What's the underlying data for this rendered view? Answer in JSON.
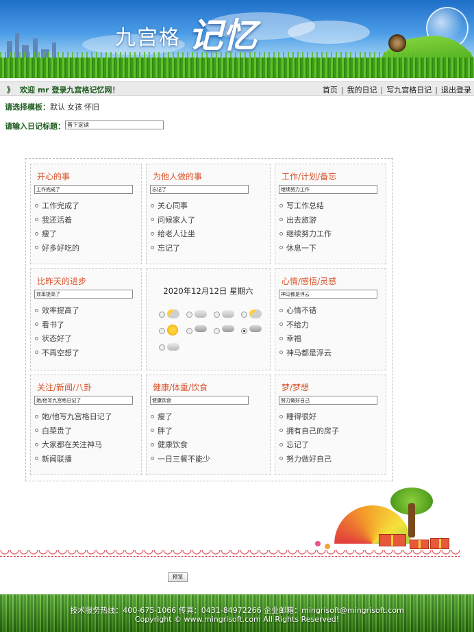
{
  "banner": {
    "logo_text": "九宫格",
    "logo_script": "记忆"
  },
  "topbar": {
    "welcome": "欢迎 mr 登录九宫格记忆网！",
    "nav": [
      "首页",
      "我的日记",
      "写九宫格日记",
      "退出登录"
    ]
  },
  "template": {
    "label": "请选择模板：",
    "options": [
      "默认",
      "女孩",
      "怀旧"
    ]
  },
  "title": {
    "label": "请输入日记标题：",
    "value": "晋下定读"
  },
  "cells": [
    {
      "title": "开心的事",
      "input": "工作完成了",
      "items": [
        "工作完成了",
        "我还活着",
        "瘦了",
        "好多好吃的"
      ]
    },
    {
      "title": "为他人做的事",
      "input": "忘记了",
      "items": [
        "关心同事",
        "问候家人了",
        "给老人让坐",
        "忘记了"
      ]
    },
    {
      "title": "工作/计划/备忘",
      "input": "继续努力工作",
      "items": [
        "写工作总结",
        "出去旅游",
        "继续努力工作",
        "休息一下"
      ]
    },
    {
      "title": "比昨天的进步",
      "input": "效率提高了",
      "items": [
        "效率提高了",
        "看书了",
        "状态好了",
        "不再空想了"
      ]
    },
    {
      "title": "心情/感悟/灵感",
      "input": "神马都是浮云",
      "items": [
        "心情不错",
        "不给力",
        "幸福",
        "神马都是浮云"
      ]
    },
    {
      "title": "关注/新闻/八卦",
      "input": "她/他写九宫格日记了",
      "items": [
        "她/他写九宫格日记了",
        "白菜贵了",
        "大家都在关注神马",
        "新闻联播"
      ]
    },
    {
      "title": "健康/体重/饮食",
      "input": "健康饮食",
      "items": [
        "瘦了",
        "胖了",
        "健康饮食",
        "一日三餐不能少"
      ]
    },
    {
      "title": "梦/梦想",
      "input": "努力做好自己",
      "items": [
        "睡得很好",
        "拥有自己的房子",
        "忘记了",
        "努力做好自己"
      ]
    }
  ],
  "weather": {
    "date": "2020年12月12日 星期六",
    "icons": [
      "cloudy-sun-icon",
      "cloudy-icon",
      "cloudy-icon",
      "sun-cloud-icon",
      "storm-icon",
      "sunny-icon",
      "rain-icon",
      "rain-icon",
      "thunder-rain-icon",
      "snow-icon",
      "cloudy-icon"
    ],
    "selected_index": 9
  },
  "preview_button": "预览",
  "footer": {
    "line1": "技术服务热线：400-675-1066 传真：0431-84972266 企业邮箱：mingrisoft@mingrisoft.com",
    "line2": "Copyright © www.mingrisoft.com All Rights Reserved!"
  },
  "colors": {
    "title_green": "#1f5d1f",
    "cell_title": "#d9532a"
  }
}
